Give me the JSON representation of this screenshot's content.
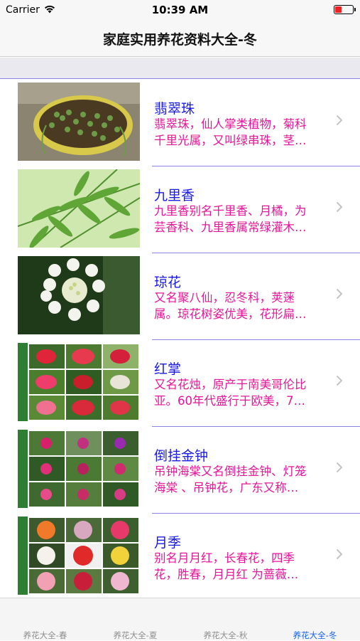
{
  "status_bar": {
    "carrier": "Carrier",
    "time": "10:39 AM",
    "wifi_icon": "wifi-icon",
    "battery_icon": "battery-icon"
  },
  "nav": {
    "title": "家庭实用养花资料大全-冬"
  },
  "items": [
    {
      "title": "翡翠珠",
      "desc_line1": "翡翠珠，仙人掌类植物，菊科",
      "desc_line2": "千里光属，又叫绿串珠，茎…",
      "thumb": "succulent-pot"
    },
    {
      "title": "九里香",
      "desc_line1": "九里香别名千里香、月橘，为",
      "desc_line2": "芸香科、九里香属常绿灌木…",
      "thumb": "green-leaves"
    },
    {
      "title": "琼花",
      "desc_line1": "又名聚八仙，忍冬科，荚蒾",
      "desc_line2": "属。琼花树姿优美，花形扁…",
      "thumb": "white-flower"
    },
    {
      "title": "红掌",
      "desc_line1": "又名花烛，原产于南美哥伦比",
      "desc_line2": "亚。60年代盛行于欧美，7…",
      "thumb": "anthurium-collage"
    },
    {
      "title": "倒挂金钟",
      "desc_line1": "吊钟海棠又名倒挂金钟、灯笼",
      "desc_line2": "海棠 、吊钟花，广东又称…",
      "thumb": "fuchsia-collage"
    },
    {
      "title": "月季",
      "desc_line1": "别名月月红，长春花，四季",
      "desc_line2": "花，胜春，月月红 为蔷薇…",
      "thumb": "rose-collage"
    }
  ],
  "tabs": [
    {
      "label": "养花大全-春",
      "active": false
    },
    {
      "label": "养花大全-夏",
      "active": false
    },
    {
      "label": "养花大全-秋",
      "active": false
    },
    {
      "label": "养花大全-冬",
      "active": true
    }
  ],
  "colors": {
    "title_blue": "#1a1ae6",
    "desc_magenta": "#e6169a",
    "separator": "#8b84e0",
    "tab_active": "#1560f0"
  }
}
